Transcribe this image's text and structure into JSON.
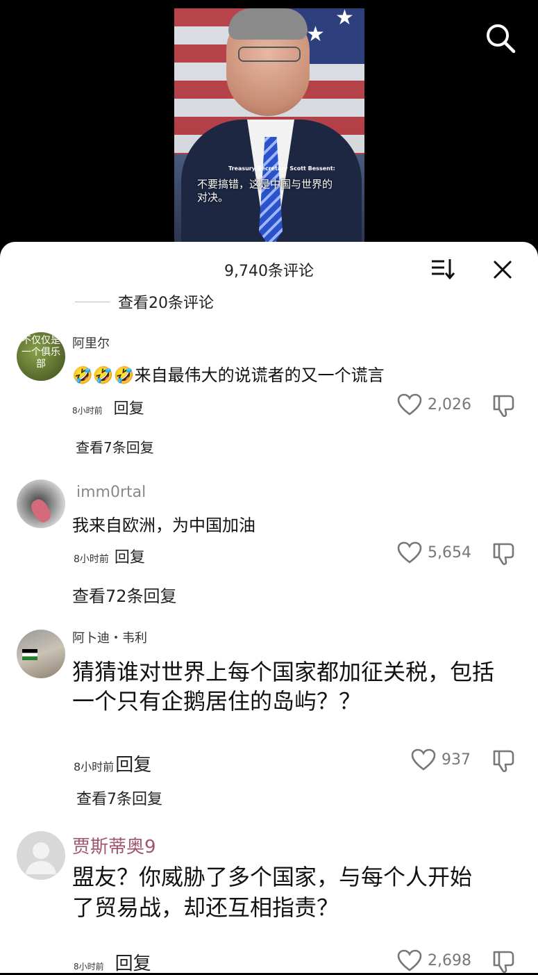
{
  "video": {
    "caption_name": "Treasury Secretary Scott Bessent:",
    "caption_text": "不要搞错，这是中国与世界的对决。"
  },
  "sheet": {
    "title": "9,740条评论",
    "view_earlier": "查看20条评论"
  },
  "comments": [
    {
      "username": "阿里尔",
      "avatar_text": "不仅仅是一个俱乐部",
      "emoji": "🤣🤣🤣",
      "text": "来自最伟大的说谎者的又一个谎言",
      "time": "8小时前",
      "reply": "回复",
      "likes": "2,026",
      "more_replies": "查看7条回复"
    },
    {
      "username": "imm0rtal",
      "text": "我来自欧洲，为中国加油",
      "time": "8小时前",
      "reply": "回复",
      "likes": "5,654",
      "more_replies": "查看72条回复"
    },
    {
      "username": "阿卜迪・韦利",
      "text": "猜猜谁对世界上每个国家都加征关税，包括一个只有企鹅居住的岛屿？？",
      "time": "8小时前",
      "reply": "回复",
      "likes": "937",
      "more_replies": "查看7条回复"
    },
    {
      "username": "贾斯蒂奥9",
      "username_color": "#a0566a",
      "text": "盟友？你威胁了多个国家，与每个人开始了贸易战，却还互相指责？",
      "time": "8小时前",
      "reply": "回复",
      "likes": "2,698"
    }
  ]
}
